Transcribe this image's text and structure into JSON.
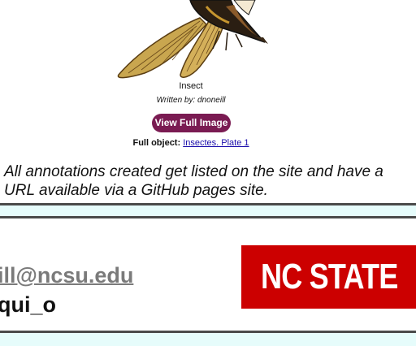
{
  "annotation": {
    "image_alt": "insect illustration",
    "title": "Insect",
    "author_line": "Written by: dnoneill",
    "view_button_label": "View Full Image",
    "full_object_label": "Full object:",
    "full_object_link": "Insectes. Plate 1"
  },
  "body_text": "All annotations created get listed on the site and have a URL available via a GitHub pages site.",
  "footer": {
    "email": "ill@ncsu.edu",
    "handle": "qui_o",
    "logo_text": "NC STATE"
  },
  "colors": {
    "button": "#7a1b52",
    "logo_red": "#cc0000",
    "band": "#e6fcfb",
    "rule": "#4a4a4a",
    "link": "#1a0dab"
  }
}
